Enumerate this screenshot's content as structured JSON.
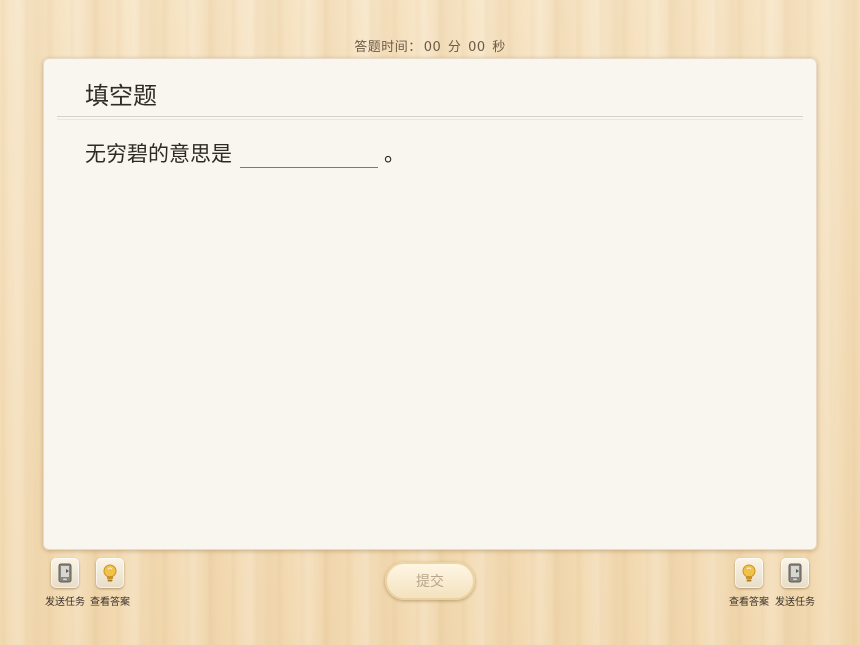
{
  "timer": {
    "label": "答题时间：",
    "minutes": "00",
    "minute_unit": "分",
    "seconds": "00",
    "second_unit": "秒"
  },
  "card": {
    "title": "填空题",
    "question_text": "无穷碧的意思是",
    "blank_value": "",
    "period": "。"
  },
  "left_tools": {
    "send_task": {
      "label": "发送任务",
      "icon": "task-phone-icon"
    },
    "view_answer": {
      "label": "查看答案",
      "icon": "lightbulb-icon"
    }
  },
  "right_tools": {
    "view_answer": {
      "label": "查看答案",
      "icon": "lightbulb-icon"
    },
    "send_task": {
      "label": "发送任务",
      "icon": "task-phone-icon"
    }
  },
  "submit": {
    "label": "提交"
  },
  "colors": {
    "background": "#f3dcb6",
    "card": "#f9f6ef",
    "text": "#2f2a25",
    "submit_text": "#b7a68a"
  }
}
